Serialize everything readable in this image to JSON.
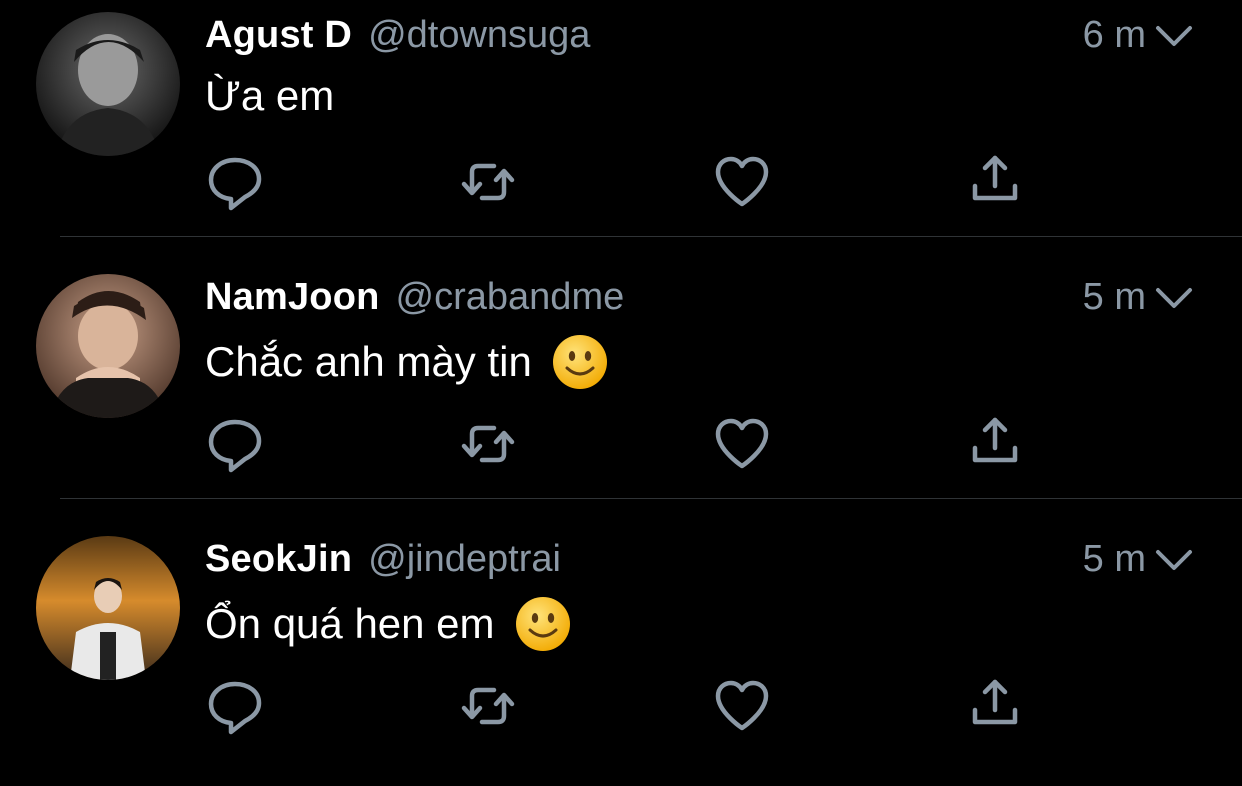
{
  "tweets": [
    {
      "display_name": "Agust D",
      "handle": "@dtownsuga",
      "time": "6 m",
      "text": "Ừa em",
      "emoji": ""
    },
    {
      "display_name": "NamJoon",
      "handle": "@crabandme",
      "time": "5 m",
      "text": "Chắc anh mày tin",
      "emoji": "slightly-smiling-face"
    },
    {
      "display_name": "SeokJin",
      "handle": "@jindeptrai",
      "time": "5 m",
      "text": "Ổn quá hen em",
      "emoji": "slightly-smiling-face"
    }
  ],
  "icons": {
    "reply": "reply-icon",
    "retweet": "retweet-icon",
    "like": "heart-icon",
    "share": "share-icon",
    "menu": "chevron-down-icon"
  },
  "colors": {
    "background": "#000000",
    "primary_text": "#ffffff",
    "secondary_text": "#8b98a5",
    "divider": "#2f3336",
    "emoji": "#f9c23c"
  }
}
